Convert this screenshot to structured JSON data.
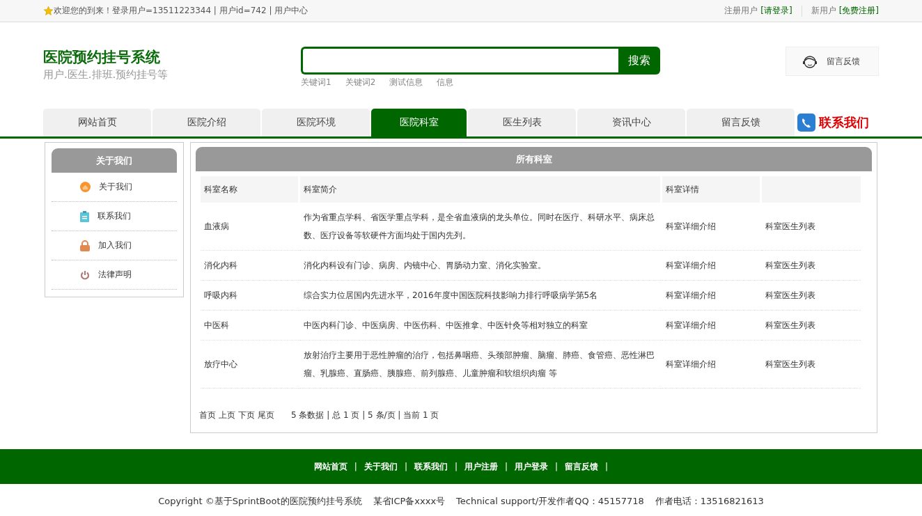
{
  "top_bar": {
    "welcome": "欢迎您的到来！登录用户=13511223344 | 用户id=742 | 用户中心",
    "login_prompt": "注册用户",
    "login_link": "[请登录]",
    "register_prompt": "新用户",
    "register_link": "[免费注册]"
  },
  "header": {
    "title": "医院预约挂号系统",
    "subtitle": "用户.医生.排班.预约挂号等",
    "search_button": "搜索",
    "keywords": [
      "关键词1",
      "关键词2",
      "测试信息",
      "信息"
    ],
    "feedback": "留言反馈"
  },
  "nav": {
    "items": [
      {
        "label": "网站首页",
        "selected": false
      },
      {
        "label": "医院介绍",
        "selected": false
      },
      {
        "label": "医院环境",
        "selected": false
      },
      {
        "label": "医院科室",
        "selected": true
      },
      {
        "label": "医生列表",
        "selected": false
      },
      {
        "label": "资讯中心",
        "selected": false
      },
      {
        "label": "留言反馈",
        "selected": false
      }
    ],
    "contact": "联系我们"
  },
  "sidebar": {
    "title": "关于我们",
    "items": [
      {
        "label": "关于我们",
        "kind": "home"
      },
      {
        "label": "联系我们",
        "kind": "clipboard"
      },
      {
        "label": "加入我们",
        "kind": "lock"
      },
      {
        "label": "法律声明",
        "kind": "power"
      }
    ]
  },
  "content": {
    "title": "所有科室",
    "columns": [
      "科室名称",
      "科室简介",
      "科室详情"
    ],
    "rows": [
      {
        "name": "血液病",
        "intro": "作为省重点学科、省医学重点学科，是全省血液病的龙头单位。同时在医疗、科研水平、病床总数、医疗设备等软硬件方面均处于国内先列。",
        "detail": "科室详细介绍",
        "doctors": "科室医生列表"
      },
      {
        "name": "消化内科",
        "intro": "消化内科设有门诊、病房、内镜中心、胃肠动力室、消化实验室。",
        "detail": "科室详细介绍",
        "doctors": "科室医生列表"
      },
      {
        "name": "呼吸内科",
        "intro": "综合实力位居国内先进水平，2016年度中国医院科技影响力排行呼吸病学第5名",
        "detail": "科室详细介绍",
        "doctors": "科室医生列表"
      },
      {
        "name": "中医科",
        "intro": "中医内科门诊、中医病房、中医伤科、中医推拿、中医针灸等相对独立的科室",
        "detail": "科室详细介绍",
        "doctors": "科室医生列表"
      },
      {
        "name": "放疗中心",
        "intro": "放射治疗主要用于恶性肿瘤的治疗，包括鼻咽癌、头颈部肿瘤、脑瘤、肺癌、食管癌、恶性淋巴瘤、乳腺癌、直肠癌、胰腺癌、前列腺癌、儿童肿瘤和软组织肉瘤 等",
        "detail": "科室详细介绍",
        "doctors": "科室医生列表"
      }
    ],
    "pager": [
      "首页",
      "上页",
      "下页",
      "尾页"
    ],
    "pager_info": "5 条数据 | 总 1 页 | 5 条/页 | 当前 1 页"
  },
  "footer": {
    "links": [
      "网站首页",
      "关于我们",
      "联系我们",
      "用户注册",
      "用户登录",
      "留言反馈"
    ],
    "separator": "|",
    "copyright": "Copyright ©基于SprintBoot的医院预约挂号系统",
    "icp": "某省ICP备xxxx号",
    "support": "Technical support/开发作者QQ：45157718",
    "phone": "作者电话：13516821613"
  }
}
